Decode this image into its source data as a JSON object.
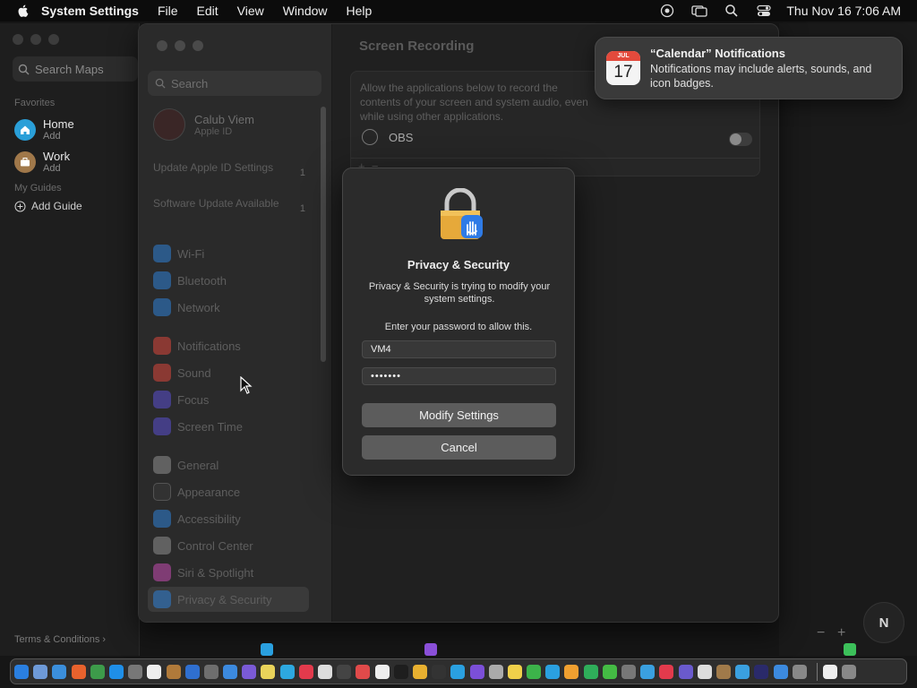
{
  "menubar": {
    "app_name": "System Settings",
    "menus": [
      "File",
      "Edit",
      "View",
      "Window",
      "Help"
    ],
    "clock": "Thu Nov 16  7:06 AM",
    "status_icons": [
      "screen-recording-icon",
      "screen-mirroring-icon",
      "spotlight-icon",
      "control-center-icon"
    ]
  },
  "maps": {
    "search_placeholder": "Search Maps",
    "favorites_label": "Favorites",
    "favorites": [
      {
        "name": "Home",
        "sub": "Add",
        "color": "#2a9fd8"
      },
      {
        "name": "Work",
        "sub": "Add",
        "color": "#a0784a"
      }
    ],
    "guides_label": "My Guides",
    "add_guide": "Add Guide",
    "terms": "Terms & Conditions",
    "compass": "N",
    "zoom_minus": "−",
    "zoom_plus": "+"
  },
  "settings": {
    "search_placeholder": "Search",
    "account": {
      "name": "Calub Viem",
      "sub": "Apple ID"
    },
    "notes": [
      {
        "text": "Update Apple ID Settings",
        "badge": "1"
      },
      {
        "text": "Software Update Available",
        "badge": "1"
      }
    ],
    "sidebar_items": [
      {
        "label": "Wi-Fi",
        "icon": "wifi-icon",
        "color": "#2d7fd6"
      },
      {
        "label": "Bluetooth",
        "icon": "bluetooth-icon",
        "color": "#2d7fd6"
      },
      {
        "label": "Network",
        "icon": "network-icon",
        "color": "#2d7fd6"
      },
      {
        "label": "Notifications",
        "icon": "notifications-icon",
        "color": "#d9453b"
      },
      {
        "label": "Sound",
        "icon": "sound-icon",
        "color": "#d9453b"
      },
      {
        "label": "Focus",
        "icon": "focus-icon",
        "color": "#5a4fcf"
      },
      {
        "label": "Screen Time",
        "icon": "screen-time-icon",
        "color": "#5a4fcf"
      },
      {
        "label": "General",
        "icon": "general-icon",
        "color": "#8e8e8e"
      },
      {
        "label": "Appearance",
        "icon": "appearance-icon",
        "color": "#3a3a3a"
      },
      {
        "label": "Accessibility",
        "icon": "accessibility-icon",
        "color": "#2d7fd6"
      },
      {
        "label": "Control Center",
        "icon": "control-center-icon",
        "color": "#8e8e8e"
      },
      {
        "label": "Siri & Spotlight",
        "icon": "siri-icon",
        "color": "#c44bb0"
      },
      {
        "label": "Privacy & Security",
        "icon": "privacy-icon",
        "color": "#2d7fd6"
      }
    ],
    "content_title": "Screen Recording",
    "content_desc": "Allow the applications below to record the contents of your screen and system audio, even while using other applications.",
    "app_row": "OBS",
    "toggle_on": false
  },
  "dialog": {
    "title": "Privacy & Security",
    "message": "Privacy & Security is trying to modify your system settings.",
    "prompt": "Enter your password to allow this.",
    "username": "VM4",
    "password": "•••••••",
    "modify_label": "Modify Settings",
    "cancel_label": "Cancel"
  },
  "notification": {
    "title": "“Calendar” Notifications",
    "body": "Notifications may include alerts, sounds, and icon badges.",
    "icon_month": "JUL",
    "icon_day": "17"
  },
  "dock": {
    "apps": [
      "#2a7fe0",
      "#6e9ad8",
      "#3b8fdc",
      "#e8622d",
      "#3d9b4a",
      "#1f8fe8",
      "#777777",
      "#eeeeee",
      "#b07a3a",
      "#2f6fd0",
      "#6e6e6e",
      "#3c8adf",
      "#7a5ad6",
      "#e9d35a",
      "#2da8e0",
      "#e23a4c",
      "#dddddd",
      "#444444",
      "#e04a4a",
      "#eeeeee",
      "#1e1e1e",
      "#e8b030",
      "#333333",
      "#2aa0e0",
      "#7b4fd8",
      "#aaaaaa",
      "#f0d04a",
      "#3cb34a",
      "#2aa0e0",
      "#f0a030",
      "#2fae5a",
      "#44bb44",
      "#777777",
      "#3aa0e0",
      "#e23a4c",
      "#6a5acd",
      "#dddddd",
      "#a07a4a",
      "#3aa0e0",
      "#2a2a6a",
      "#3c8adf",
      "#888888",
      "#eeeeee",
      "#888888"
    ]
  }
}
